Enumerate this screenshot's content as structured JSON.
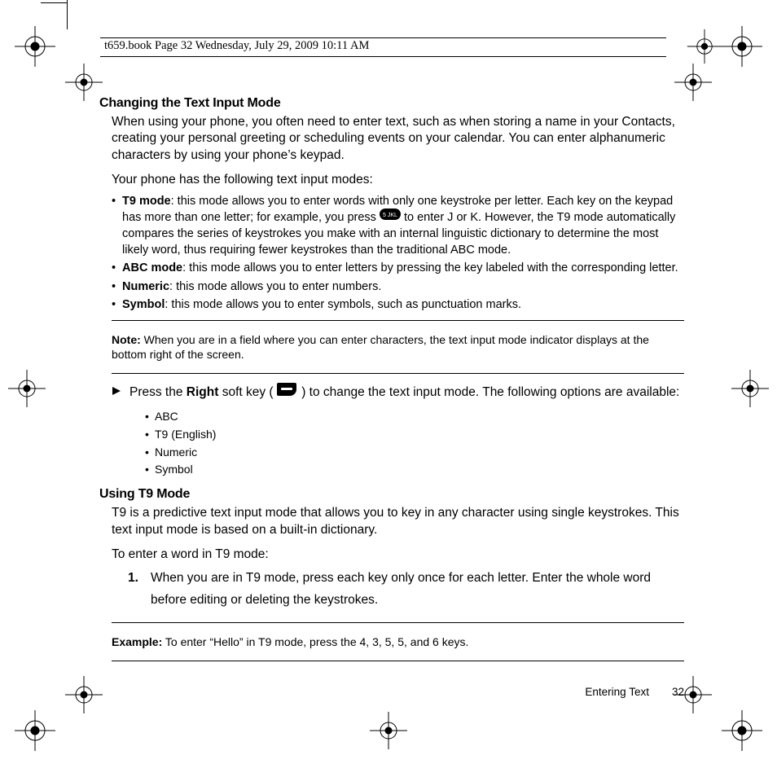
{
  "header": {
    "meta_line": "t659.book  Page 32  Wednesday, July 29, 2009  10:11 AM"
  },
  "section1": {
    "heading": "Changing the Text Input Mode",
    "para1": "When using your phone, you often need to enter text, such as when storing a name in your Contacts, creating your personal greeting or scheduling events on your calendar. You can enter alphanumeric characters by using your phone’s keypad.",
    "para2": "Your phone has the following text input modes:",
    "bullets": [
      {
        "label": "T9 mode",
        "pre": ": this mode allows you to enter words with only one keystroke per letter. Each key on the keypad has more than one letter; for example, you press ",
        "post": " to enter J or K. However, the T9 mode automatically compares the series of keystrokes you make with an internal linguistic dictionary to determine the most likely word, thus requiring fewer keystrokes than the traditional ABC mode."
      },
      {
        "label": "ABC mode",
        "text": ": this mode allows you to enter letters by pressing the key labeled with the corresponding letter."
      },
      {
        "label": "Numeric",
        "text": ": this mode allows you to enter numbers."
      },
      {
        "label": "Symbol",
        "text": ": this mode allows you to enter symbols, such as punctuation marks."
      }
    ],
    "note_label": "Note:",
    "note_text": " When you are in a field where you can enter characters, the text input mode indicator displays at the bottom right of the screen.",
    "arrow1": "Press the ",
    "arrow_bold": "Right",
    "arrow2": " soft key ( ",
    "arrow3": " ) to change the text input mode.  The following options are available:",
    "options": [
      "ABC",
      "T9 (English)",
      "Numeric",
      "Symbol"
    ]
  },
  "section2": {
    "heading": "Using T9 Mode",
    "para1": "T9 is a predictive text input mode that allows you to key in any character using single keystrokes. This text input mode is based on a built-in dictionary.",
    "para2": "To enter a word in T9 mode:",
    "step_num": "1.",
    "step_text": "When you are in T9 mode, press each key only once for each letter. Enter the whole word before editing or deleting the keystrokes.",
    "example_label": "Example:",
    "example_text": " To enter “Hello” in T9 mode, press the 4, 3, 5, 5, and 6 keys."
  },
  "footer": {
    "section": "Entering Text",
    "page": "32"
  }
}
